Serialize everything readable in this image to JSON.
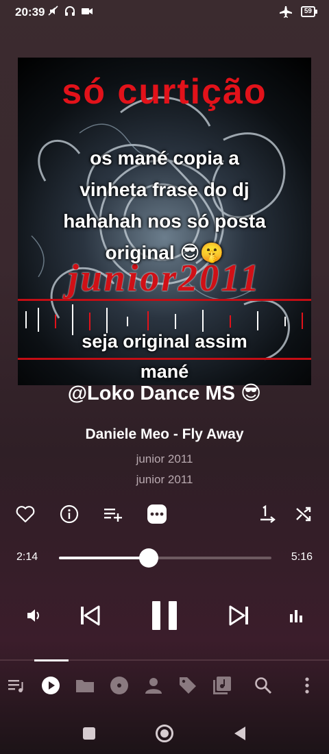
{
  "status": {
    "time": "20:39",
    "battery": "59",
    "icons": [
      "mute-icon",
      "headphones-icon",
      "video-icon",
      "airplane-icon",
      "battery-icon"
    ]
  },
  "artwork": {
    "banner_top": "só curtição",
    "banner_mid": "junior2011",
    "caption_lines": [
      "os mané copia a",
      "vinheta frase do dj",
      "hahahah nos só posta",
      "original 😎🤫"
    ],
    "caption2_lines": [
      "seja original assim",
      "mané"
    ]
  },
  "credit": "@Loko Dance MS 😎",
  "track": {
    "title": "Daniele Meo - Fly Away",
    "artist": "junior 2011",
    "album": "junior 2011"
  },
  "actions": [
    "heart-icon",
    "info-icon",
    "add-to-queue-icon",
    "more-icon",
    "sort-icon",
    "shuffle-icon"
  ],
  "progress": {
    "current": "2:14",
    "duration": "5:16",
    "fraction": 0.424
  },
  "controls": [
    "volume-icon",
    "previous-icon",
    "pause-icon",
    "next-icon",
    "equalizer-icon"
  ],
  "nav": {
    "items": [
      "queue-icon",
      "now-playing-icon",
      "folder-icon",
      "album-icon",
      "artist-icon",
      "tag-icon",
      "library-icon",
      "search-icon",
      "more-vert-icon"
    ],
    "active_index": 1
  },
  "colors": {
    "accent_red": "#e2121a",
    "bg": "#3a282e"
  }
}
